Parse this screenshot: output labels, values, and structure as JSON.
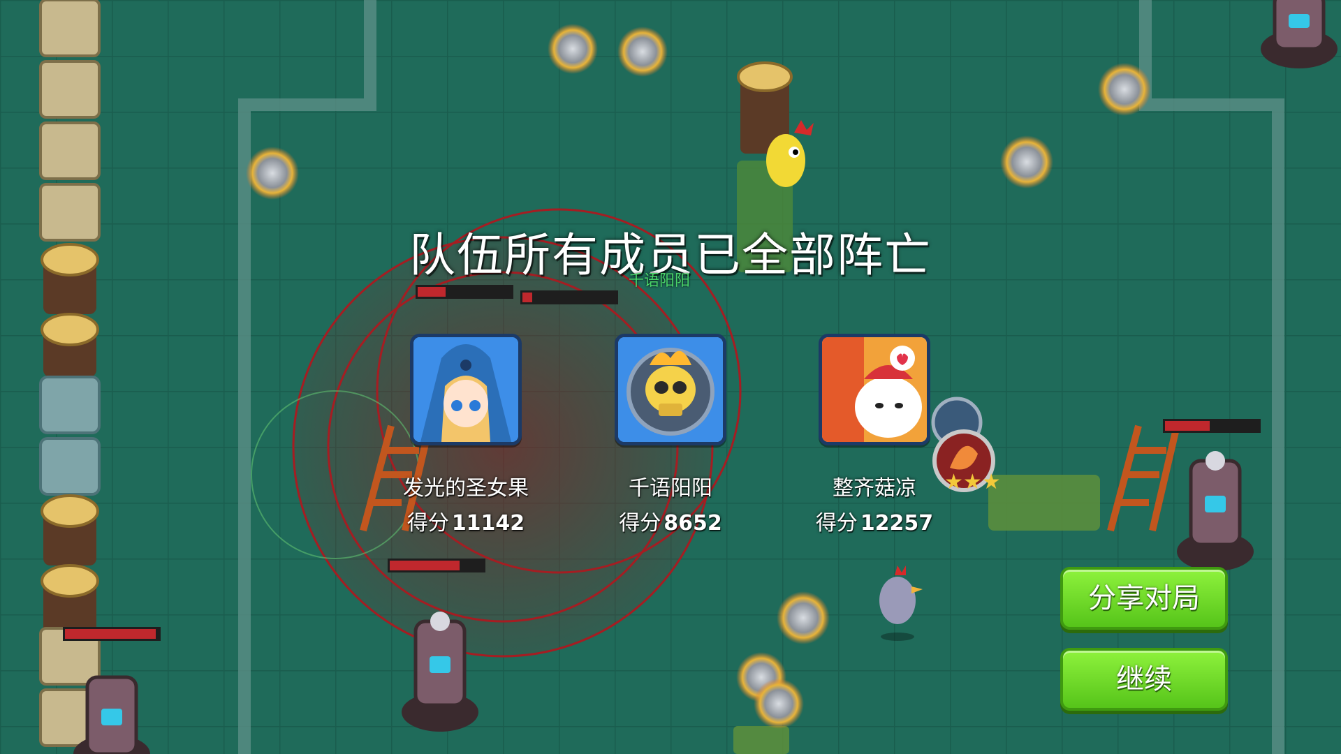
{
  "overlay": {
    "title": "队伍所有成员已全部阵亡",
    "score_label": "得分"
  },
  "ally_name_tag": "千语阳阳",
  "players": [
    {
      "name": "发光的圣女果",
      "score": "11142",
      "avatar_icon": "mage-girl-avatar-icon"
    },
    {
      "name": "千语阳阳",
      "score": "8652",
      "avatar_icon": "flaming-skull-avatar-icon"
    },
    {
      "name": "整齐菇凉",
      "score": "12257",
      "avatar_icon": "cartoon-character-avatar-icon"
    }
  ],
  "buttons": {
    "share": "分享对局",
    "continue": "继续"
  },
  "colors": {
    "floor": "#1f6b5a",
    "button_green": "#6ed828",
    "health_red": "#c0282d"
  }
}
